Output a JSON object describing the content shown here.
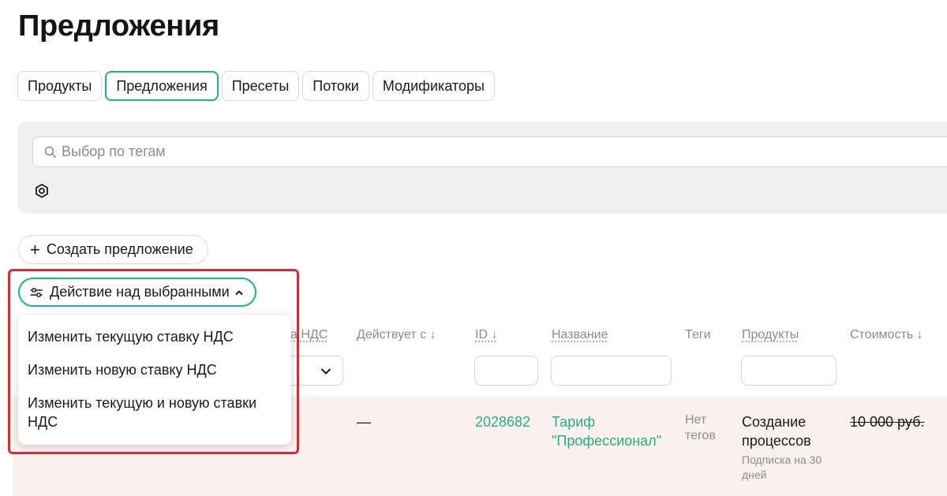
{
  "page": {
    "title": "Предложения"
  },
  "tabs": [
    {
      "label": "Продукты",
      "active": false
    },
    {
      "label": "Предложения",
      "active": true
    },
    {
      "label": "Пресеты",
      "active": false
    },
    {
      "label": "Потоки",
      "active": false
    },
    {
      "label": "Модификаторы",
      "active": false
    }
  ],
  "filters": {
    "tag_search_placeholder": "Выбор по тегам",
    "settings_icon": "hexagon-settings-icon"
  },
  "toolbar": {
    "create_label": "Создать предложение",
    "action_label": "Действие над выбранными"
  },
  "action_menu": {
    "items": [
      "Изменить текущую ставку НДС",
      "Изменить новую ставку НДС",
      "Изменить текущую и новую ставки НДС"
    ]
  },
  "table": {
    "columns": {
      "vat_partial": "а НДС",
      "active_from": "Действует с ↓",
      "id": "ID ↓",
      "name": "Название",
      "tags": "Теги",
      "products": "Продукты",
      "price": "Стоимость ↓"
    },
    "rows": [
      {
        "active_from": "—",
        "id": "2028682",
        "name": "Тариф \"Профессионал\"",
        "tags": "Нет тегов",
        "product": "Создание процессов",
        "product_note": "Подписка на 30 дней",
        "price": "10 000 руб."
      }
    ]
  },
  "colors": {
    "accent": "#1eb386",
    "highlight": "#e0282e",
    "row_bg": "#fdf0f0",
    "panel_bg": "#f0f0f0"
  }
}
